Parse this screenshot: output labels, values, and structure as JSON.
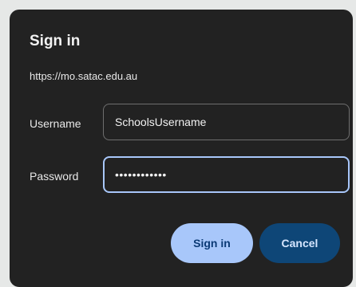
{
  "dialog": {
    "title": "Sign in",
    "url": "https://mo.satac.edu.au",
    "username_label": "Username",
    "username_value": "SchoolsUsername",
    "password_label": "Password",
    "password_value": "••••••••••••",
    "signin_button": "Sign in",
    "cancel_button": "Cancel"
  },
  "colors": {
    "dialog_background": "#222222",
    "page_background": "#e6e8e7",
    "focus_border": "#a8c7fa",
    "primary_button": "#a8c7fa",
    "secondary_button": "#0e4677"
  }
}
